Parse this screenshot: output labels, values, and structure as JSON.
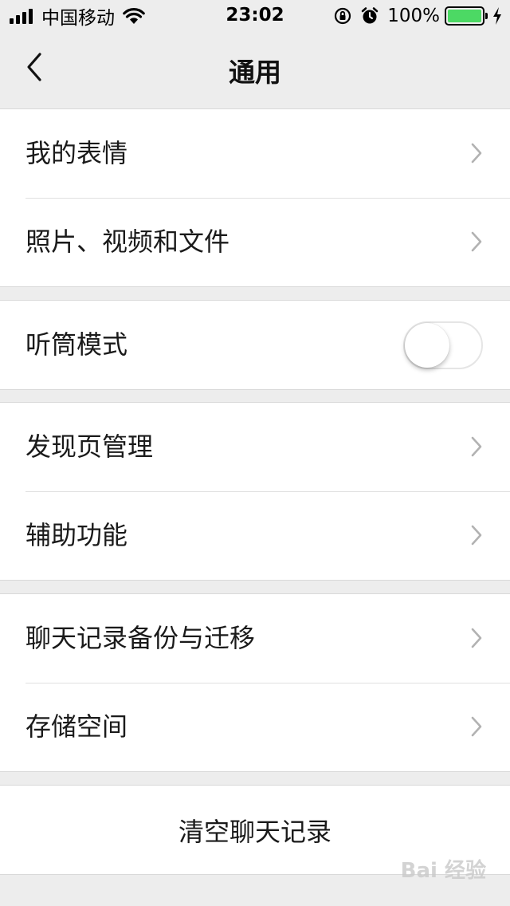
{
  "status_bar": {
    "carrier": "中国移动",
    "time": "23:02",
    "battery_percent": "100%",
    "battery_color": "#4cd964"
  },
  "nav": {
    "title": "通用",
    "back_icon": "chevron-left-icon"
  },
  "groups": [
    {
      "items": [
        {
          "label": "我的表情"
        },
        {
          "label": "照片、视频和文件"
        }
      ]
    },
    {
      "items": [
        {
          "label": "听筒模式",
          "toggle": false
        }
      ]
    },
    {
      "items": [
        {
          "label": "发现页管理"
        },
        {
          "label": "辅助功能"
        }
      ]
    },
    {
      "items": [
        {
          "label": "聊天记录备份与迁移"
        },
        {
          "label": "存储空间"
        }
      ]
    }
  ],
  "clear_chat": {
    "label": "清空聊天记录"
  },
  "watermark": "Bai 经验"
}
